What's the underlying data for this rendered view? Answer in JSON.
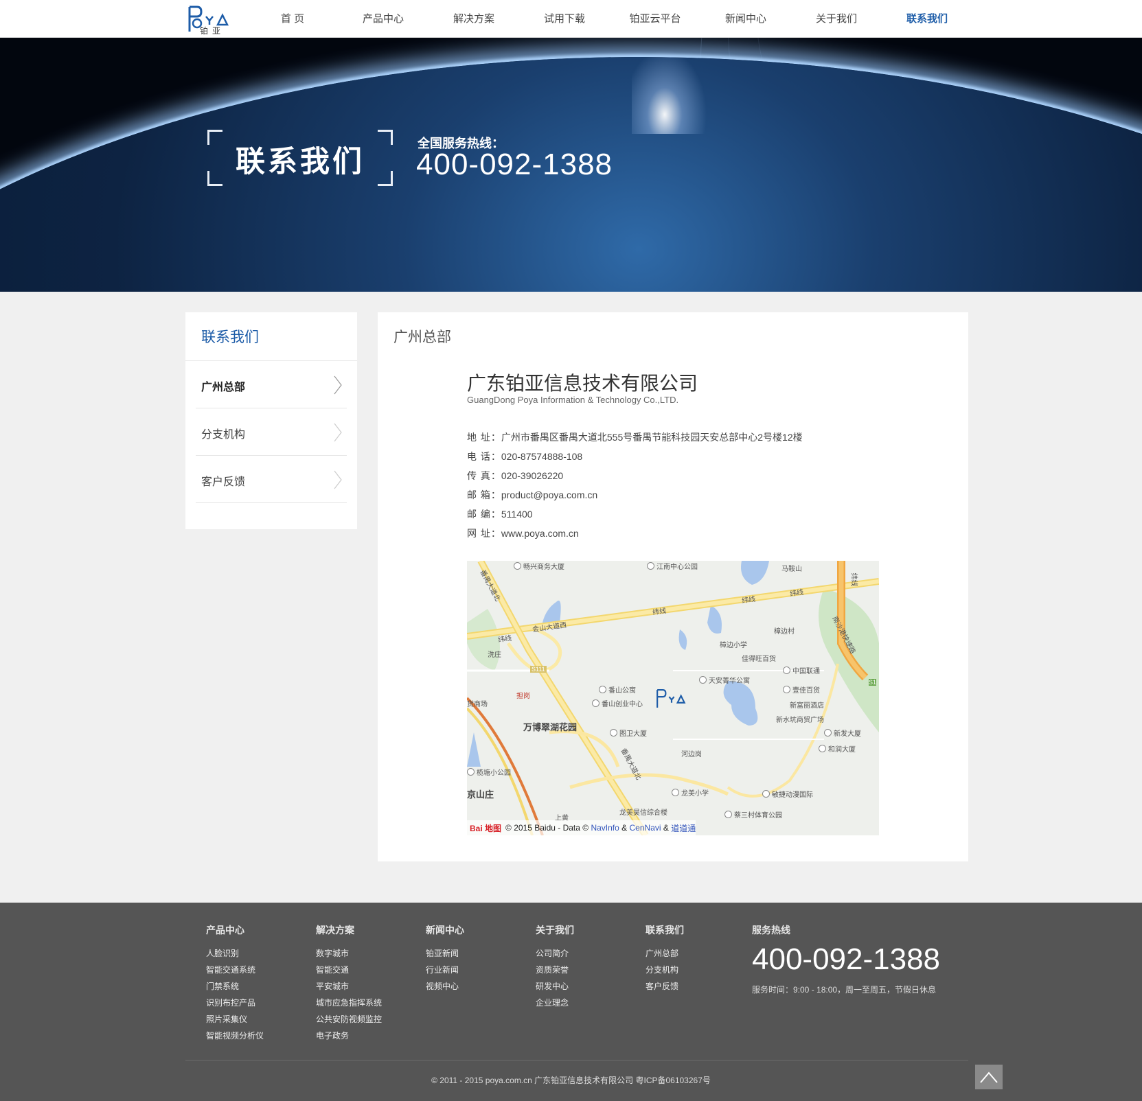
{
  "header": {
    "logo_text": "POYA",
    "logo_sub": "铂亚",
    "nav": [
      {
        "label": "首 页"
      },
      {
        "label": "产品中心"
      },
      {
        "label": "解决方案"
      },
      {
        "label": "试用下载"
      },
      {
        "label": "铂亚云平台"
      },
      {
        "label": "新闻中心"
      },
      {
        "label": "关于我们"
      },
      {
        "label": "联系我们",
        "active": true
      }
    ]
  },
  "banner": {
    "title": "联系我们",
    "hotline_label": "全国服务热线：",
    "hotline_number": "400-092-1388"
  },
  "sidebar": {
    "title": "联系我们",
    "items": [
      {
        "label": "广州总部",
        "active": true
      },
      {
        "label": "分支机构"
      },
      {
        "label": "客户反馈"
      }
    ]
  },
  "main": {
    "title": "广州总部",
    "company_cn": "广东铂亚信息技术有限公司",
    "company_en": "GuangDong Poya Information & Technology Co.,LTD.",
    "info": [
      {
        "key": "地 址：",
        "value": "广州市番禺区番禺大道北555号番禺节能科技园天安总部中心2号楼12楼"
      },
      {
        "key": "电 话：",
        "value": "020-87574888-108"
      },
      {
        "key": "传 真：",
        "value": "020-39026220"
      },
      {
        "key": "邮 箱：",
        "value": "product@poya.com.cn"
      },
      {
        "key": "邮 编：",
        "value": "511400"
      },
      {
        "key": "网 址：",
        "value": "www.poya.com.cn"
      }
    ]
  },
  "map": {
    "labels": [
      "畅兴商务大厦",
      "江南中心公园",
      "马鞍山",
      "番禺大道北",
      "金山大道西",
      "纬线",
      "纬线",
      "纬线",
      "纬线",
      "纬线",
      "南沙港快速路",
      "樟边村",
      "樟边小学",
      "佳得旺百货",
      "中国联通",
      "洗庄",
      "S111",
      "天安菁华公寓",
      "壹佳百货",
      "番山公寓",
      "番山创业中心",
      "新富丽酒店",
      "新水坑商贸广场",
      "新发大厦",
      "和润大厦",
      "货商场",
      "担岗",
      "万博翠湖花园",
      "图卫大厦",
      "河边岗",
      "番禺大道北",
      "榄塘小公园",
      "京山庄",
      "龙美小学",
      "敏捷动漫国际",
      "龙美昊信综合楼",
      "蔡三村体育公园",
      "上黄",
      "S1"
    ],
    "credit_logo": "Bai 地图",
    "credit_text": "© 2015 Baidu - Data ©",
    "credit_link1": "NavInfo",
    "credit_amp1": "&",
    "credit_link2": "CenNavi",
    "credit_amp2": "&",
    "credit_link3": "道道通"
  },
  "footer": {
    "columns": [
      {
        "heading": "产品中心",
        "links": [
          "人脸识别",
          "智能交通系统",
          "门禁系统",
          "识别布控产品",
          "照片采集仪",
          "智能视频分析仪"
        ]
      },
      {
        "heading": "解决方案",
        "links": [
          "数字城市",
          "智能交通",
          "平安城市",
          "城市应急指挥系统",
          "公共安防视频监控",
          "电子政务"
        ]
      },
      {
        "heading": "新闻中心",
        "links": [
          "铂亚新闻",
          "行业新闻",
          "视频中心"
        ]
      },
      {
        "heading": "关于我们",
        "links": [
          "公司简介",
          "资质荣誉",
          "研发中心",
          "企业理念"
        ]
      },
      {
        "heading": "联系我们",
        "links": [
          "广州总部",
          "分支机构",
          "客户反馈"
        ]
      }
    ],
    "service_heading": "服务热线",
    "service_phone": "400-092-1388",
    "service_hours": "服务时间：9:00 - 18:00，周一至周五，节假日休息",
    "copyright": "© 2011 - 2015 poya.com.cn 广东铂亚信息技术有限公司 粤ICP备06103267号"
  },
  "colors": {
    "accent": "#1d5ca8",
    "footer_bg": "#555555",
    "page_bg": "#f0f0f0"
  }
}
